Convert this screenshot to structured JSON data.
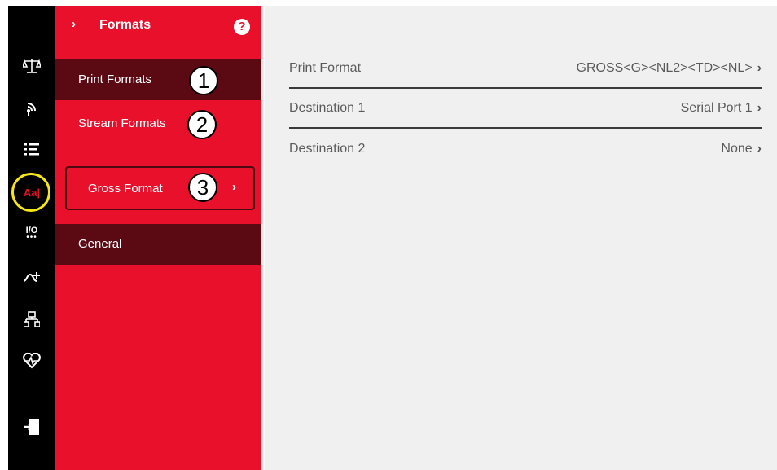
{
  "rail": {
    "icons": [
      "scale-icon",
      "wireless-icon",
      "list-icon",
      "formats-icon",
      "io-icon",
      "setpoint-icon",
      "network-icon",
      "diagnostics-icon",
      "logout-icon"
    ],
    "formats_glyph": "Aa|",
    "io_glyph": "I/O",
    "highlight_color": "#f5e619"
  },
  "panel": {
    "header_chevron": "›",
    "title": "Formats",
    "help": "?",
    "items": [
      {
        "label": "Print Formats",
        "badge": "1"
      },
      {
        "label": "Stream Formats",
        "badge": "2"
      },
      {
        "label": "Gross Format",
        "badge": "3",
        "chevron": "›"
      },
      {
        "label": "General"
      }
    ],
    "color": "#e8102b",
    "dark_color": "#5b0a14"
  },
  "content": {
    "rows": [
      {
        "label": "Print Format",
        "value": "GROSS<G><NL2><TD><NL>",
        "arrow": "›"
      },
      {
        "label": "Destination 1",
        "value": "Serial Port 1",
        "arrow": "›"
      },
      {
        "label": "Destination 2",
        "value": "None",
        "arrow": "›"
      }
    ]
  }
}
